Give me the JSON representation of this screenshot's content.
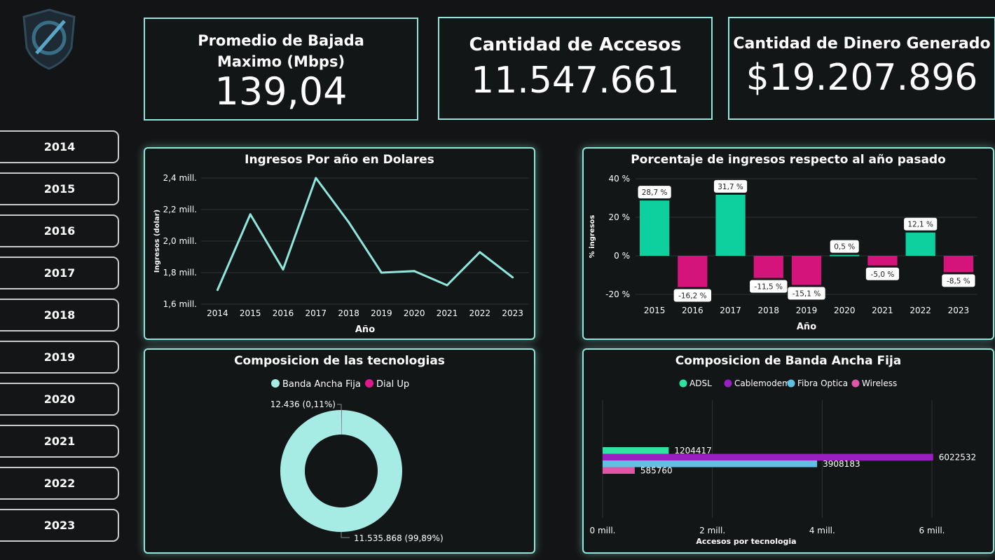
{
  "colors": {
    "accent": "#8fe7dc",
    "background": "#131415",
    "panel": "#121617",
    "positive": "#0ecf9e",
    "negative": "#d4147a",
    "donut_main": "#a6ebe4",
    "donut_small": "#e0188f",
    "adsl": "#2de3a0",
    "cablemodem": "#9a1fc2",
    "fibra": "#5ec1e3",
    "wireless": "#e055a6"
  },
  "logo": {
    "icon": "shield-icon"
  },
  "year_filter": [
    "2014",
    "2015",
    "2016",
    "2017",
    "2018",
    "2019",
    "2020",
    "2021",
    "2022",
    "2023"
  ],
  "kpis": {
    "download": {
      "title": "Promedio de Bajada Maximo (Mbps)",
      "value": "139,04"
    },
    "accesos": {
      "title": "Cantidad de Accesos",
      "value": "11.547.661"
    },
    "dinero": {
      "title": "Cantidad de Dinero Generado",
      "value": "$19.207.896"
    }
  },
  "chart_data": [
    {
      "id": "ingresos",
      "type": "line",
      "title": "Ingresos Por año en Dolares",
      "xlabel": "Año",
      "ylabel": "Ingresos (dolar)",
      "x": [
        "2014",
        "2015",
        "2016",
        "2017",
        "2018",
        "2019",
        "2020",
        "2021",
        "2022",
        "2023"
      ],
      "values": [
        1.69,
        2.17,
        1.82,
        2.4,
        2.12,
        1.8,
        1.81,
        1.72,
        1.93,
        1.77
      ],
      "ylim": [
        1.6,
        2.4
      ],
      "yticks": [
        1.6,
        1.8,
        2.0,
        2.2,
        2.4
      ],
      "ytick_labels": [
        "1,6 mill.",
        "1,8 mill.",
        "2,0 mill.",
        "2,2 mill.",
        "2,4 mill."
      ],
      "grid": true
    },
    {
      "id": "porcentaje",
      "type": "bar",
      "title": "Porcentaje de ingresos respecto al año pasado",
      "xlabel": "Año",
      "ylabel": "% ingresos",
      "categories": [
        "2015",
        "2016",
        "2017",
        "2018",
        "2019",
        "2020",
        "2021",
        "2022",
        "2023"
      ],
      "values": [
        28.7,
        -16.2,
        31.7,
        -11.5,
        -15.1,
        0.5,
        -5.0,
        12.1,
        -8.5
      ],
      "data_labels": [
        "28,7 %",
        "-16,2 %",
        "31,7 %",
        "-11,5 %",
        "-15,1 %",
        "0,5 %",
        "-5,0 %",
        "12,1 %",
        "-8,5 %"
      ],
      "ylim": [
        -20,
        40
      ],
      "yticks": [
        -20,
        0,
        20,
        40
      ],
      "ytick_labels": [
        "-20 %",
        "0 %",
        "20 %",
        "40 %"
      ],
      "grid": true
    },
    {
      "id": "tecnologias",
      "type": "pie",
      "title": "Composicion de las tecnologias",
      "legend": [
        "Banda Ancha Fija",
        "Dial Up"
      ],
      "values": [
        11535868,
        12436
      ],
      "data_labels": [
        "11.535.868 (99,89%)",
        "12.436 (0,11%)"
      ],
      "legend_position": "top"
    },
    {
      "id": "banda",
      "type": "bar",
      "title": "Composicion de Banda Ancha Fija",
      "xlabel": "Accesos por tecnologia",
      "series": [
        {
          "name": "ADSL",
          "values": [
            1204417
          ],
          "label": "1204417"
        },
        {
          "name": "Cablemodem",
          "values": [
            6022532
          ],
          "label": "6022532"
        },
        {
          "name": "Fibra Optica",
          "values": [
            3908183
          ],
          "label": "3908183"
        },
        {
          "name": "Wireless",
          "values": [
            585760
          ],
          "label": "585760"
        }
      ],
      "xlim": [
        0,
        6000000
      ],
      "xticks": [
        0,
        2000000,
        4000000,
        6000000
      ],
      "xtick_labels": [
        "0 mill.",
        "2 mill.",
        "4 mill.",
        "6 mill."
      ],
      "legend_position": "top",
      "grid": true
    }
  ]
}
